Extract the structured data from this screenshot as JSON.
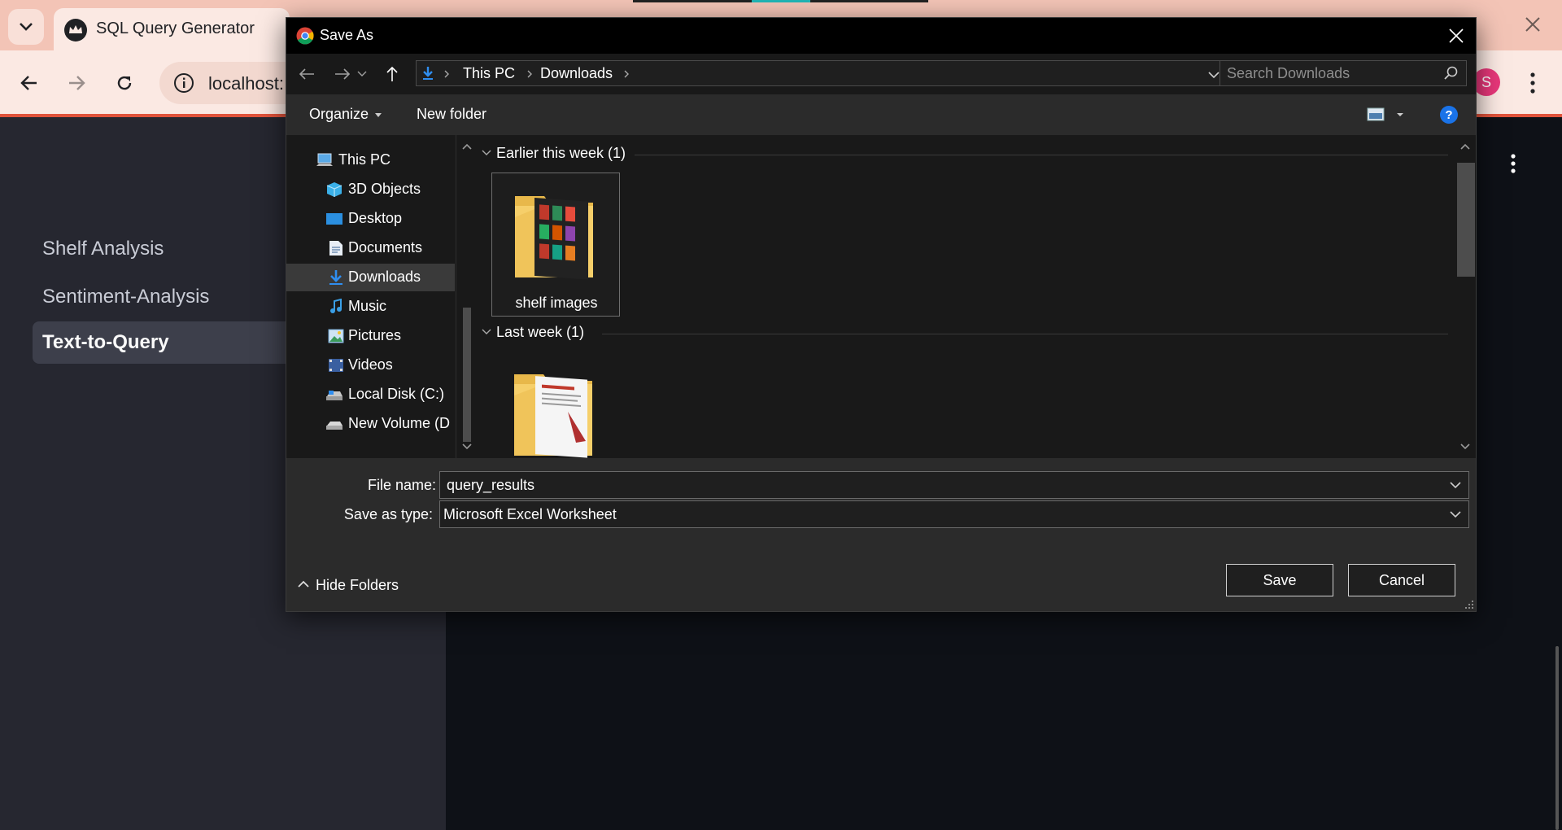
{
  "browser": {
    "tab_title": "SQL Query Generator",
    "url": "localhost:",
    "profile_initial": "S"
  },
  "sidebar": {
    "items": [
      {
        "label": "Shelf Analysis",
        "active": false
      },
      {
        "label": "Sentiment-Analysis",
        "active": false
      },
      {
        "label": "Text-to-Query",
        "active": true
      }
    ]
  },
  "dialog": {
    "title": "Save As",
    "breadcrumb": [
      "This PC",
      "Downloads"
    ],
    "search_placeholder": "Search Downloads",
    "organize_label": "Organize",
    "new_folder_label": "New folder",
    "help_label": "?",
    "nav_pane": [
      {
        "label": "This PC",
        "icon": "computer-icon"
      },
      {
        "label": "3D Objects",
        "icon": "cube-icon"
      },
      {
        "label": "Desktop",
        "icon": "desktop-icon"
      },
      {
        "label": "Documents",
        "icon": "document-icon"
      },
      {
        "label": "Downloads",
        "icon": "download-icon",
        "selected": true
      },
      {
        "label": "Music",
        "icon": "music-icon"
      },
      {
        "label": "Pictures",
        "icon": "pictures-icon"
      },
      {
        "label": "Videos",
        "icon": "video-icon"
      },
      {
        "label": "Local Disk (C:)",
        "icon": "drive-icon"
      },
      {
        "label": "New Volume (D",
        "icon": "drive-icon"
      }
    ],
    "groups": [
      {
        "header": "Earlier this week (1)",
        "files": [
          {
            "name": "shelf images"
          }
        ]
      },
      {
        "header": "Last week (1)",
        "files": [
          {
            "name": ""
          }
        ]
      }
    ],
    "file_name_label": "File name:",
    "file_name_value": "query_results",
    "save_type_label": "Save as type:",
    "save_type_value": "Microsoft Excel Worksheet",
    "hide_folders_label": "Hide Folders",
    "save_label": "Save",
    "cancel_label": "Cancel"
  },
  "colors": {
    "tabbar": "#f3c4b6",
    "toolbar": "#fbe9e3",
    "accent_line": "#e0533b",
    "sidebar_bg": "#262730",
    "app_bg": "#0e1117",
    "dialog_bg": "#191919",
    "panel_bg": "#2b2b2b",
    "help_blue": "#1a73e8"
  }
}
